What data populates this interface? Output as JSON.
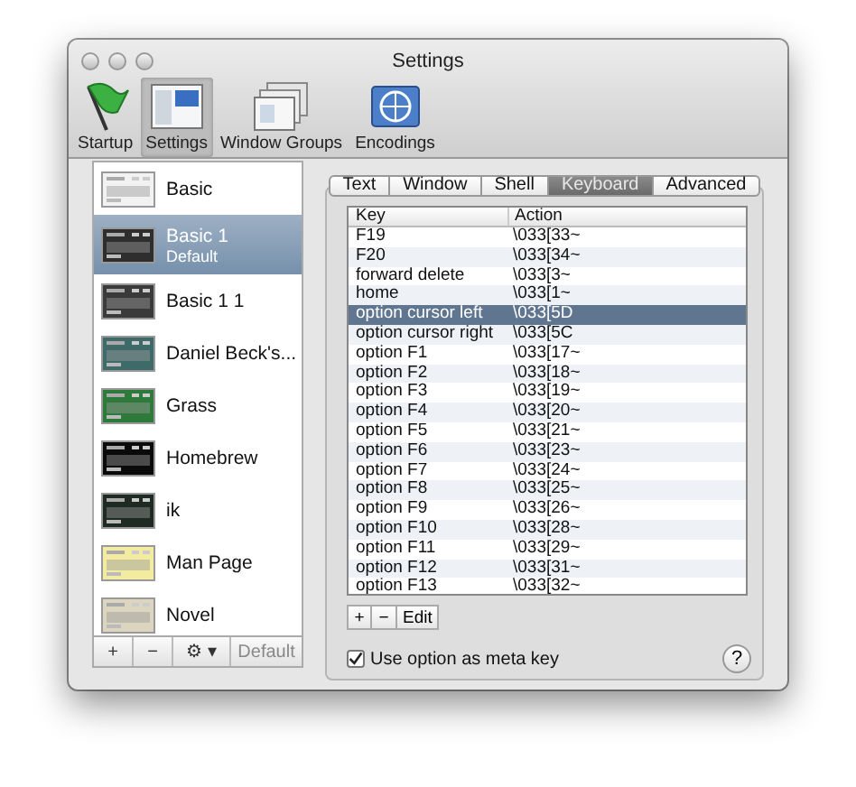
{
  "window": {
    "title": "Settings"
  },
  "toolbar": [
    {
      "label": "Startup",
      "kind": "flag",
      "selected": false
    },
    {
      "label": "Settings",
      "kind": "settings",
      "selected": true
    },
    {
      "label": "Window Groups",
      "kind": "windows",
      "selected": false
    },
    {
      "label": "Encodings",
      "kind": "globe",
      "selected": false
    }
  ],
  "profiles": [
    {
      "name": "Basic",
      "color": "#f2f2f2",
      "selected": false
    },
    {
      "name": "Basic 1",
      "subtitle": "Default",
      "color": "#2e2e2e",
      "selected": true
    },
    {
      "name": "Basic 1 1",
      "color": "#3a3a3a",
      "selected": false
    },
    {
      "name": "Daniel Beck's...",
      "color": "#3f6a6a",
      "selected": false
    },
    {
      "name": "Grass",
      "color": "#2e7a3a",
      "selected": false
    },
    {
      "name": "Homebrew",
      "color": "#0a0a0a",
      "selected": false
    },
    {
      "name": "ik",
      "color": "#1e2a22",
      "selected": false
    },
    {
      "name": "Man Page",
      "color": "#f3eba0",
      "selected": false
    },
    {
      "name": "Novel",
      "color": "#dcd6c0",
      "selected": false
    }
  ],
  "profile_buttons": [
    "+",
    "−",
    "⚙ ▾",
    "Default"
  ],
  "tabs": [
    {
      "label": "Text",
      "selected": false
    },
    {
      "label": "Window",
      "selected": false
    },
    {
      "label": "Shell",
      "selected": false
    },
    {
      "label": "Keyboard",
      "selected": true
    },
    {
      "label": "Advanced",
      "selected": false
    }
  ],
  "table": {
    "columns": [
      "Key",
      "Action"
    ],
    "rows": [
      {
        "key": "F19",
        "action": "\\033[33~",
        "selected": false
      },
      {
        "key": "F20",
        "action": "\\033[34~",
        "selected": false
      },
      {
        "key": "forward delete",
        "action": "\\033[3~",
        "selected": false
      },
      {
        "key": "home",
        "action": "\\033[1~",
        "selected": false
      },
      {
        "key": "option cursor left",
        "action": "\\033[5D",
        "selected": true
      },
      {
        "key": "option cursor right",
        "action": "\\033[5C",
        "selected": false
      },
      {
        "key": "option F1",
        "action": "\\033[17~",
        "selected": false
      },
      {
        "key": "option F2",
        "action": "\\033[18~",
        "selected": false
      },
      {
        "key": "option F3",
        "action": "\\033[19~",
        "selected": false
      },
      {
        "key": "option F4",
        "action": "\\033[20~",
        "selected": false
      },
      {
        "key": "option F5",
        "action": "\\033[21~",
        "selected": false
      },
      {
        "key": "option F6",
        "action": "\\033[23~",
        "selected": false
      },
      {
        "key": "option F7",
        "action": "\\033[24~",
        "selected": false
      },
      {
        "key": "option F8",
        "action": "\\033[25~",
        "selected": false
      },
      {
        "key": "option F9",
        "action": "\\033[26~",
        "selected": false
      },
      {
        "key": "option F10",
        "action": "\\033[28~",
        "selected": false
      },
      {
        "key": "option F11",
        "action": "\\033[29~",
        "selected": false
      },
      {
        "key": "option F12",
        "action": "\\033[31~",
        "selected": false
      },
      {
        "key": "option F13",
        "action": "\\033[32~",
        "selected": false
      }
    ]
  },
  "table_buttons": [
    "+",
    "−",
    "Edit"
  ],
  "meta_key": {
    "label": "Use option as meta key",
    "checked": true
  },
  "help": {
    "label": "?"
  }
}
